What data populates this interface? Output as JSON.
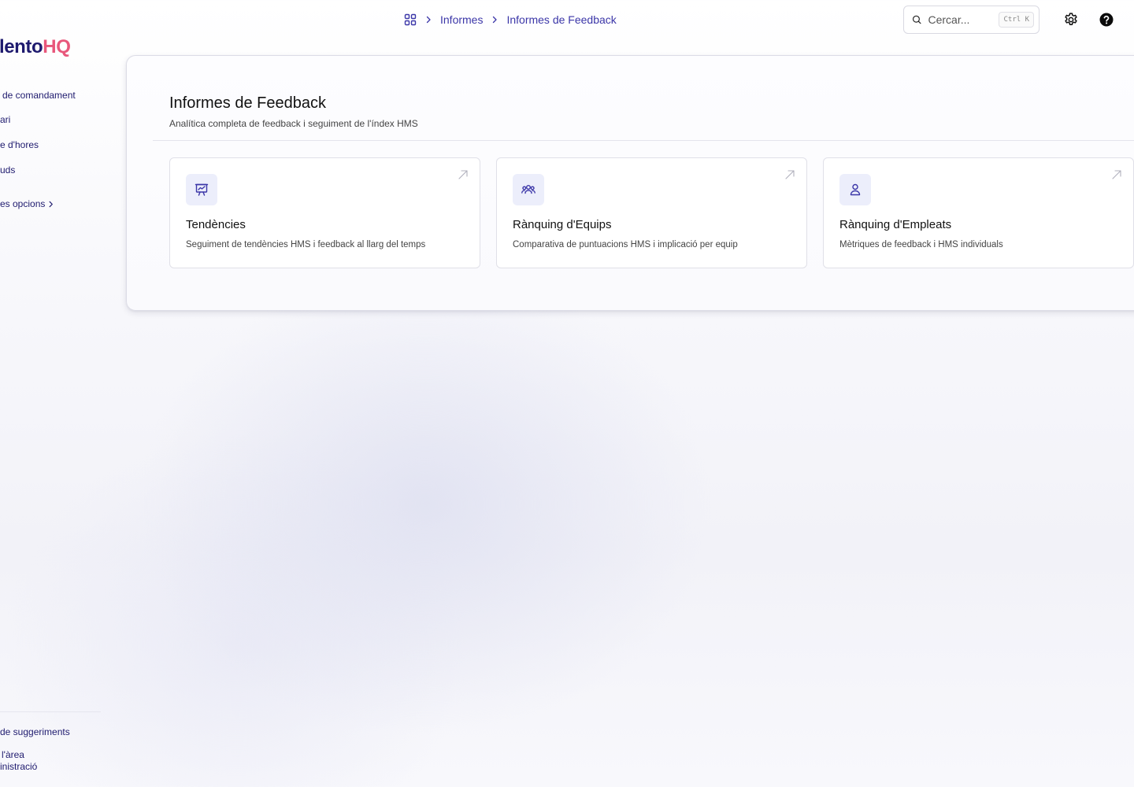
{
  "app": {
    "logo_part1": "alentoHQ",
    "logo_part1_main": "alento",
    "logo_part2": "HQ"
  },
  "sidebar": {
    "items": [
      {
        "label": "de comandament"
      },
      {
        "label": "ari"
      },
      {
        "label": "e d'hores"
      },
      {
        "label": "uds"
      }
    ],
    "more_label": "es opcions",
    "footer": {
      "suggestions_label": "de suggeriments",
      "admin_line1": "l'àrea",
      "admin_line2": "inistració"
    }
  },
  "breadcrumb": {
    "items": [
      "Informes",
      "Informes de Feedback"
    ]
  },
  "search": {
    "placeholder": "Cercar...",
    "shortcut": "Ctrl K"
  },
  "page": {
    "title": "Informes de Feedback",
    "subtitle": "Analítica completa de feedback i seguiment de l'índex HMS"
  },
  "cards": [
    {
      "title": "Tendències",
      "description": "Seguiment de tendències HMS i feedback al llarg del temps",
      "icon": "presentation-chart-icon"
    },
    {
      "title": "Rànquing d'Equips",
      "description": "Comparativa de puntuacions HMS i implicació per equip",
      "icon": "users-group-icon"
    },
    {
      "title": "Rànquing d'Empleats",
      "description": "Mètriques de feedback i HMS individuals",
      "icon": "user-icon"
    }
  ],
  "colors": {
    "brand_primary": "#1e1a6e",
    "brand_accent": "#e8577b",
    "link": "#3b36a8",
    "icon_bg": "#eceefb"
  }
}
